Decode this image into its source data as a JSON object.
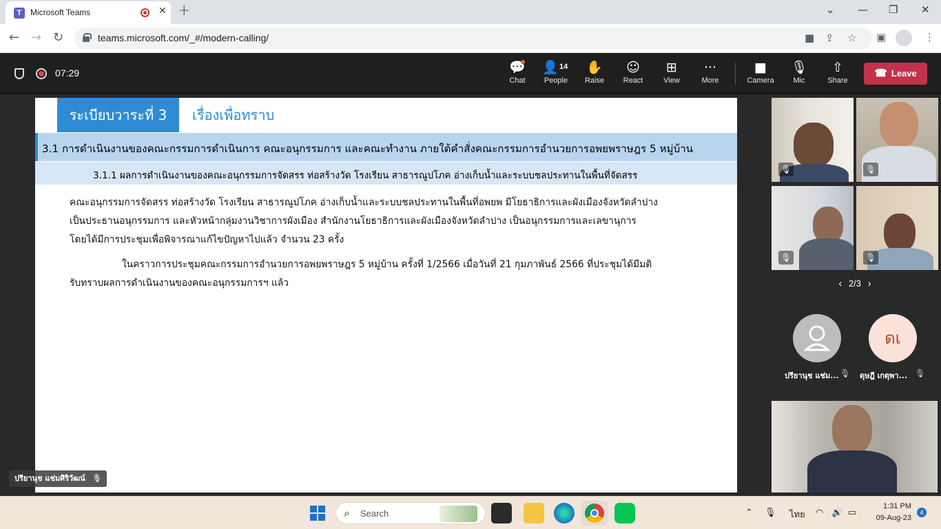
{
  "browser": {
    "tab_title": "Microsoft Teams",
    "tab_close": "✕",
    "new_tab": "+",
    "url": "teams.microsoft.com/_#/modern-calling/",
    "window_controls": {
      "minimize": "⌄",
      "restore": "—",
      "maximize": "❐",
      "close": "✕"
    }
  },
  "call": {
    "timer": "07:29",
    "toolbar": {
      "chat_label": "Chat",
      "people_label": "People",
      "people_count": "14",
      "raise_label": "Raise",
      "react_label": "React",
      "view_label": "View",
      "more_label": "More",
      "camera_label": "Camera",
      "mic_label": "Mic",
      "share_label": "Share",
      "leave_label": "Leave"
    },
    "colors": {
      "leave": "#c4314b",
      "toolbar_bg": "#1f1f1f",
      "stage_bg": "#292929"
    }
  },
  "slide": {
    "agenda_label": "ระเบียบวาระที่ 3",
    "agenda_topic": "เรื่องเพื่อทราบ",
    "section_heading": "3.1  การดำเนินงานของคณะกรรมการดำเนินการ คณะอนุกรรมการ และคณะทำงาน ภายใต้คำสั่งคณะกรรมการอำนวยการอพยพราษฎร 5 หมู่บ้าน",
    "subsection_heading": "3.1.1 ผลการดำเนินงานของคณะอนุกรรมการจัดสรร ท่อสร้างวัด โรงเรียน สาธารณูปโภค อ่างเก็บน้ำและระบบชลประทานในพื้นที่จัดสรร",
    "paragraph1": [
      "คณะอนุกรรมการจัดสรร ท่อสร้างวัด โรงเรียน สาธารณูปโภค อ่างเก็บน้ำและระบบชลประทานในพื้นที่อพยพ มีโยธาธิการและผังเมืองจังหวัดลำปาง",
      "เป็นประธานอนุกรรมการ และหัวหน้ากลุ่มงานวิชาการผังเมือง สำนักงานโยธาธิการและผังเมืองจังหวัดลำปาง เป็นอนุกรรมการและเลขานุการ",
      "โดยได้มีการประชุมเพื่อพิจารณาแก้ไขปัญหาไปแล้ว จำนวน 23 ครั้ง"
    ],
    "paragraph2": [
      "ในคราวการประชุมคณะกรรมการอำนวยการอพยพราษฎร 5 หมู่บ้าน ครั้งที่ 1/2566 เมื่อวันที่ 21 กุมภาพันธ์ 2566 ที่ประชุมได้มีมติ",
      "รับทราบผลการดำเนินงานของคณะอนุกรรมการฯ แล้ว"
    ],
    "colors": {
      "accent": "#2e8bd3",
      "bar1": "#b9d5ee",
      "bar2": "#d7e6f4"
    }
  },
  "gallery": {
    "page_indicator": "2/3",
    "participants": [
      {
        "name": "ปรียานุช แช่ม...",
        "initials": "",
        "avatar_color": "#bdbdbd"
      },
      {
        "name": "ดุษฎี เกตุพา...",
        "initials": "ดเ",
        "avatar_color": "#fbe3dc"
      }
    ],
    "presenter_name": "ปรียานุช แช่มศิริวัฒน์"
  },
  "taskbar": {
    "search_label": "Search",
    "language": "ไทย",
    "time": "1:31 PM",
    "date": "09-Aug-23",
    "notifications": "4"
  }
}
